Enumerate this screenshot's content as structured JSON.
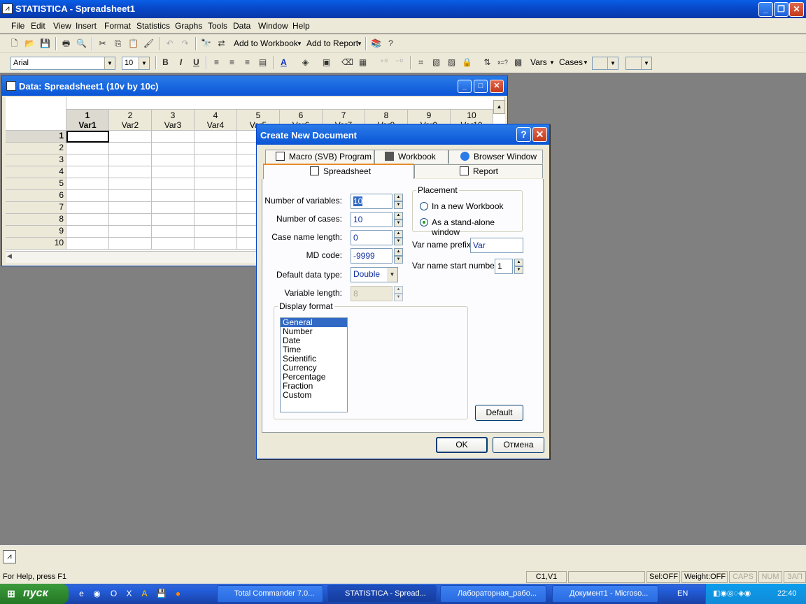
{
  "app": {
    "title": "STATISTICA - Spreadsheet1",
    "icon": "statistica-icon"
  },
  "menu": [
    "File",
    "Edit",
    "View",
    "Insert",
    "Format",
    "Statistics",
    "Graphs",
    "Tools",
    "Data",
    "Window",
    "Help"
  ],
  "toolbar1": {
    "add_to_workbook": "Add to Workbook",
    "add_to_report": "Add to Report"
  },
  "toolbar2": {
    "font": "Arial",
    "size": "10",
    "vars": "Vars",
    "cases": "Cases"
  },
  "sheet": {
    "title": "Data: Spreadsheet1 (10v by 10c)",
    "col_numbers": [
      "1",
      "2",
      "3",
      "4",
      "5",
      "6",
      "7",
      "8",
      "9",
      "10"
    ],
    "col_names": [
      "Var1",
      "Var2",
      "Var3",
      "Var4",
      "Var5",
      "Var6",
      "Var7",
      "Var8",
      "Var9",
      "Var10"
    ],
    "rows": [
      "1",
      "2",
      "3",
      "4",
      "5",
      "6",
      "7",
      "8",
      "9",
      "10"
    ]
  },
  "dialog": {
    "title": "Create New Document",
    "tabs_back": [
      "Macro (SVB) Program",
      "Workbook",
      "Browser Window"
    ],
    "tabs_front": [
      "Spreadsheet",
      "Report"
    ],
    "labels": {
      "num_vars": "Number of variables:",
      "num_cases": "Number of cases:",
      "case_name_len": "Case name length:",
      "md_code": "MD code:",
      "default_type": "Default data type:",
      "var_length": "Variable length:",
      "display_format": "Display format",
      "placement": "Placement",
      "var_prefix": "Var name prefix:",
      "var_start": "Var name start number:"
    },
    "values": {
      "num_vars": "10",
      "num_cases": "10",
      "case_name_len": "0",
      "md_code": "-9999",
      "default_type": "Double",
      "var_length": "8",
      "var_prefix": "Var",
      "var_start": "1"
    },
    "placement_options": [
      "In a new Workbook",
      "As a stand-alone window"
    ],
    "placement_selected": 1,
    "formats": [
      "General",
      "Number",
      "Date",
      "Time",
      "Scientific",
      "Currency",
      "Percentage",
      "Fraction",
      "Custom"
    ],
    "format_selected": 0,
    "buttons": {
      "default": "Default",
      "ok": "OK",
      "cancel": "Отмена"
    }
  },
  "status": {
    "help": "For Help, press F1",
    "cell": "C1,V1",
    "sel": "Sel:OFF",
    "weight": "Weight:OFF",
    "caps": "CAPS",
    "num": "NUM",
    "zap": "ЗАП"
  },
  "taskbar": {
    "start": "пуск",
    "tasks": [
      "Total Commander 7.0...",
      "STATISTICA - Spread...",
      "Лабораторная_рабо...",
      "Документ1 - Microso..."
    ],
    "lang": "EN",
    "clock": "22:40"
  }
}
